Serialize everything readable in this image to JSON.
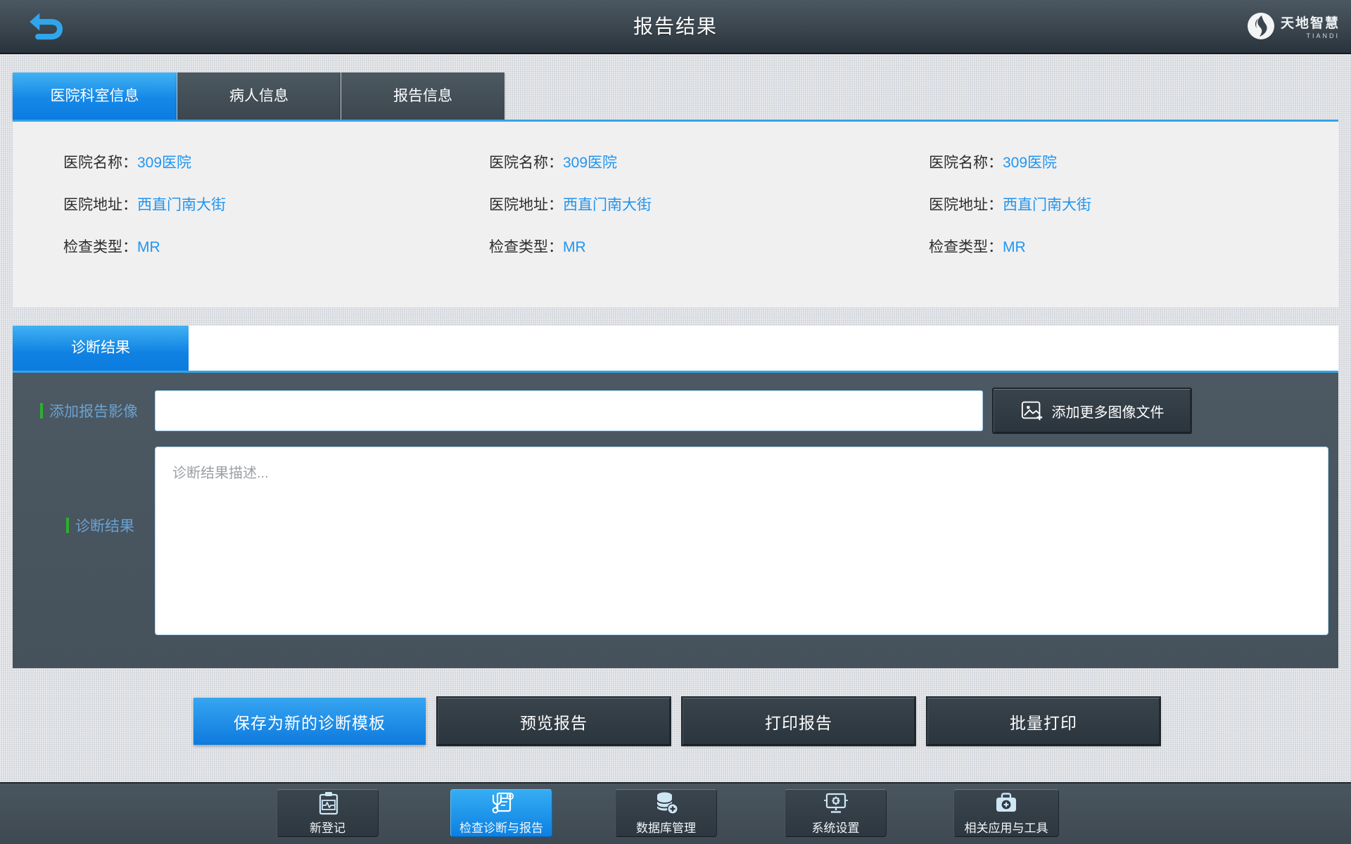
{
  "header": {
    "title": "报告结果",
    "brand_name": "天地智慧",
    "brand_sub": "TIANDI"
  },
  "info_tabs": {
    "hospital": "医院科室信息",
    "patient": "病人信息",
    "report": "报告信息"
  },
  "hospital_info": {
    "columns": [
      {
        "rows": [
          {
            "label": "医院名称：",
            "value": "309医院"
          },
          {
            "label": "医院地址：",
            "value": "西直门南大街"
          },
          {
            "label": "检查类型：",
            "value": "MR"
          }
        ]
      },
      {
        "rows": [
          {
            "label": "医院名称：",
            "value": "309医院"
          },
          {
            "label": "医院地址：",
            "value": "西直门南大街"
          },
          {
            "label": "检查类型：",
            "value": "MR"
          }
        ]
      },
      {
        "rows": [
          {
            "label": "医院名称：",
            "value": "309医院"
          },
          {
            "label": "医院地址：",
            "value": "西直门南大街"
          },
          {
            "label": "检查类型：",
            "value": "MR"
          }
        ]
      }
    ]
  },
  "diagnosis": {
    "tab": "诊断结果",
    "image_label": "添加报告影像",
    "image_input_value": "",
    "add_more_button": "添加更多图像文件",
    "result_label": "诊断结果",
    "placeholder": "诊断结果描述..."
  },
  "actions": {
    "save_template": "保存为新的诊断模板",
    "preview": "预览报告",
    "print": "打印报告",
    "batch_print": "批量打印"
  },
  "bottom_nav": {
    "items": [
      {
        "label": "新登记",
        "icon": "clipboard-pulse-icon",
        "active": false
      },
      {
        "label": "检查诊断与报告",
        "icon": "report-stethoscope-icon",
        "active": true
      },
      {
        "label": "数据库管理",
        "icon": "database-plus-icon",
        "active": false
      },
      {
        "label": "系统设置",
        "icon": "monitor-gear-icon",
        "active": false
      },
      {
        "label": "相关应用与工具",
        "icon": "toolbox-plus-icon",
        "active": false
      }
    ]
  },
  "colors": {
    "accent_blue": "#2095f0",
    "active_tab_top": "#42b2f3",
    "active_tab_bottom": "#0c7ce0",
    "green_marker": "#2fae2f",
    "dark_panel": "#47535d",
    "info_panel_bg": "#f0f0f1"
  }
}
